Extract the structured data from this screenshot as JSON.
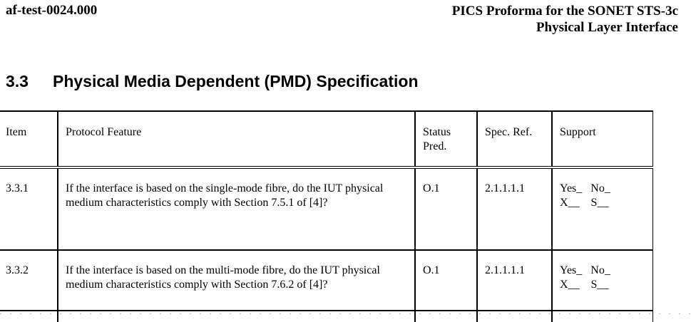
{
  "header": {
    "doc_id": "af-test-0024.000",
    "title_line1": "PICS Proforma for the SONET STS-3c",
    "title_line2": "Physical Layer Interface"
  },
  "section": {
    "number": "3.3",
    "title": "Physical Media Dependent (PMD) Specification"
  },
  "table": {
    "headers": {
      "item": "Item",
      "feature": "Protocol Feature",
      "status_line1": "Status",
      "status_line2": "Pred.",
      "spec_ref": "Spec. Ref.",
      "support": "Support"
    },
    "rows": [
      {
        "item": "3.3.1",
        "feature": "If the interface is based on the single-mode fibre, do the IUT physical medium characteristics comply with Section 7.5.1 of [4]?",
        "status": "O.1",
        "spec_ref": "2.1.1.1.1",
        "support_line1": "Yes_   No_",
        "support_line2": "X__    S__"
      },
      {
        "item": "3.3.2",
        "feature": "If the interface is based on the multi-mode fibre, do the IUT physical medium characteristics comply with Section 7.6.2 of [4]?",
        "status": "O.1",
        "spec_ref": "2.1.1.1.1",
        "support_line1": "Yes_   No_",
        "support_line2": "X__    S__"
      }
    ]
  }
}
